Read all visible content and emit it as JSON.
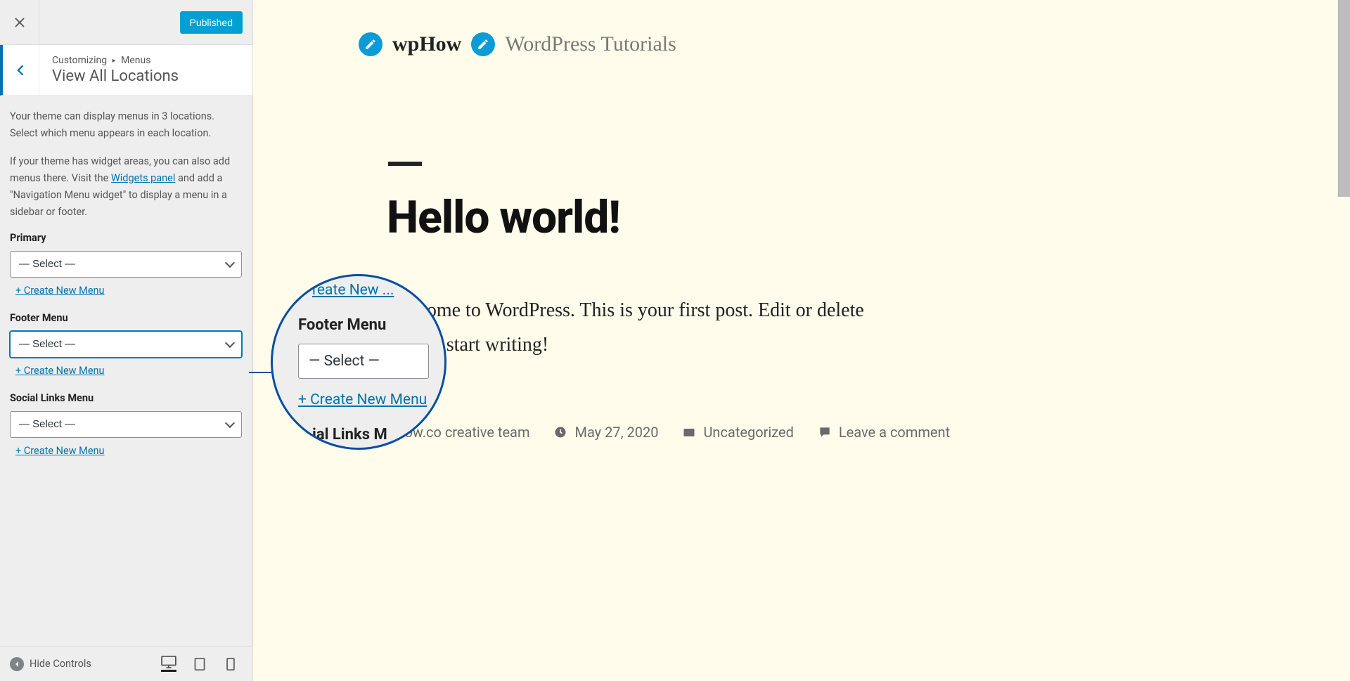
{
  "topbar": {
    "published_label": "Published"
  },
  "header": {
    "breadcrumb_root": "Customizing",
    "breadcrumb_current": "Menus",
    "title": "View All Locations"
  },
  "descriptions": {
    "p1": "Your theme can display menus in 3 locations. Select which menu appears in each location.",
    "p2a": "If your theme has widget areas, you can also add menus there. Visit the ",
    "widgets_link": "Widgets panel",
    "p2b": " and add a \"Navigation Menu widget\" to display a menu in a sidebar or footer."
  },
  "locations": [
    {
      "label": "Primary",
      "selected": "— Select —",
      "create": "+ Create New Menu",
      "highlight": false
    },
    {
      "label": "Footer Menu",
      "selected": "— Select —",
      "create": "+ Create New Menu",
      "highlight": true
    },
    {
      "label": "Social Links Menu",
      "selected": "— Select —",
      "create": "+ Create New Menu",
      "highlight": false
    }
  ],
  "footer": {
    "hide_controls": "Hide Controls"
  },
  "preview": {
    "site_name": "wpHow",
    "tagline": "WordPress Tutorials",
    "post_title": "Hello world!",
    "post_body_1": "ome to WordPress. This is your first post. Edit or delete",
    "post_body_2": " start writing!",
    "author_fragment": "pHow.co creative team",
    "date": "May 27, 2020",
    "category": "Uncategorized",
    "comment": "Leave a comment"
  },
  "magnifier": {
    "top_fragment": "reate New ...",
    "label": "Footer Menu",
    "select": "— Select —",
    "link": "+ Create New Menu",
    "bottom_fragment": "ial Links M"
  }
}
